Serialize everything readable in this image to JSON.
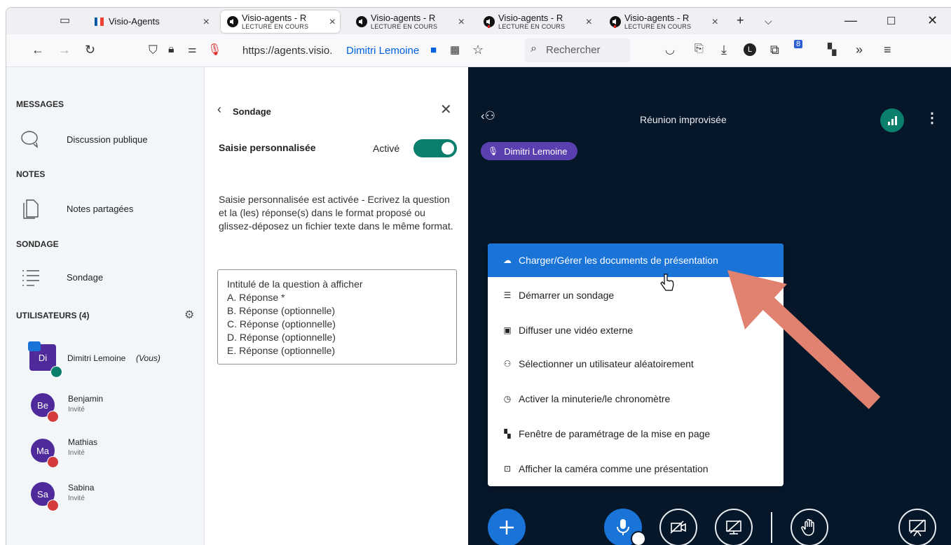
{
  "browser": {
    "tabs": [
      {
        "title": "Visio-Agents",
        "subtitle": "",
        "active": false
      },
      {
        "title": "Visio-agents - R",
        "subtitle": "LECTURE EN COURS",
        "active": true
      },
      {
        "title": "Visio-agents - R",
        "subtitle": "LECTURE EN COURS",
        "active": false
      },
      {
        "title": "Visio-agents - R",
        "subtitle": "LECTURE EN COURS",
        "active": false
      },
      {
        "title": "Visio-agents - R",
        "subtitle": "LECTURE EN COURS",
        "active": false
      }
    ],
    "url": "https://agents.visio.",
    "url_user": "Dimitri Lemoine",
    "search_placeholder": "Rechercher",
    "extension_badge": "8"
  },
  "sidebar": {
    "messages_heading": "MESSAGES",
    "public_chat": "Discussion publique",
    "notes_heading": "NOTES",
    "shared_notes": "Notes partagées",
    "poll_heading": "SONDAGE",
    "poll_item": "Sondage",
    "users_heading": "UTILISATEURS (4)",
    "users": [
      {
        "initials": "Di",
        "name": "Dimitri Lemoine",
        "suffix": "(Vous)",
        "role": ""
      },
      {
        "initials": "Be",
        "name": "Benjamin",
        "suffix": "",
        "role": "Invité"
      },
      {
        "initials": "Ma",
        "name": "Mathias",
        "suffix": "",
        "role": "Invité"
      },
      {
        "initials": "Sa",
        "name": "Sabina",
        "suffix": "",
        "role": "Invité"
      }
    ]
  },
  "poll_panel": {
    "title": "Sondage",
    "custom_input_label": "Saisie personnalisée",
    "toggle_label": "Activé",
    "description": "Saisie personnalisée est activée - Ecrivez la question et la (les) réponse(s) dans le format proposé ou glissez-déposez un fichier texte dans le même format.",
    "textarea_lines": [
      "Intitulé de la question à afficher",
      "A. Réponse *",
      "B. Réponse (optionnelle)",
      "C. Réponse (optionnelle)",
      "D. Réponse (optionnelle)",
      "E. Réponse (optionnelle)"
    ]
  },
  "meeting": {
    "title": "Réunion improvisée",
    "presenter_pill": "Dimitri Lemoine",
    "menu_items": [
      {
        "label": "Charger/Gérer les documents de présentation",
        "icon": "upload-cloud-icon"
      },
      {
        "label": "Démarrer un sondage",
        "icon": "list-icon"
      },
      {
        "label": "Diffuser une vidéo externe",
        "icon": "video-icon"
      },
      {
        "label": "Sélectionner un utilisateur aléatoirement",
        "icon": "user-icon"
      },
      {
        "label": "Activer la minuterie/le chronomètre",
        "icon": "clock-icon"
      },
      {
        "label": "Fenêtre de paramétrage de la mise en page",
        "icon": "layout-icon"
      },
      {
        "label": "Afficher la caméra comme une présentation",
        "icon": "camera-icon"
      }
    ]
  },
  "colors": {
    "accent_blue": "#1a73d6",
    "meeting_bg": "#06172a",
    "toggle_green": "#0a7f6c",
    "avatar_purple": "#4e2a9a",
    "arrow": "#e0826f"
  }
}
